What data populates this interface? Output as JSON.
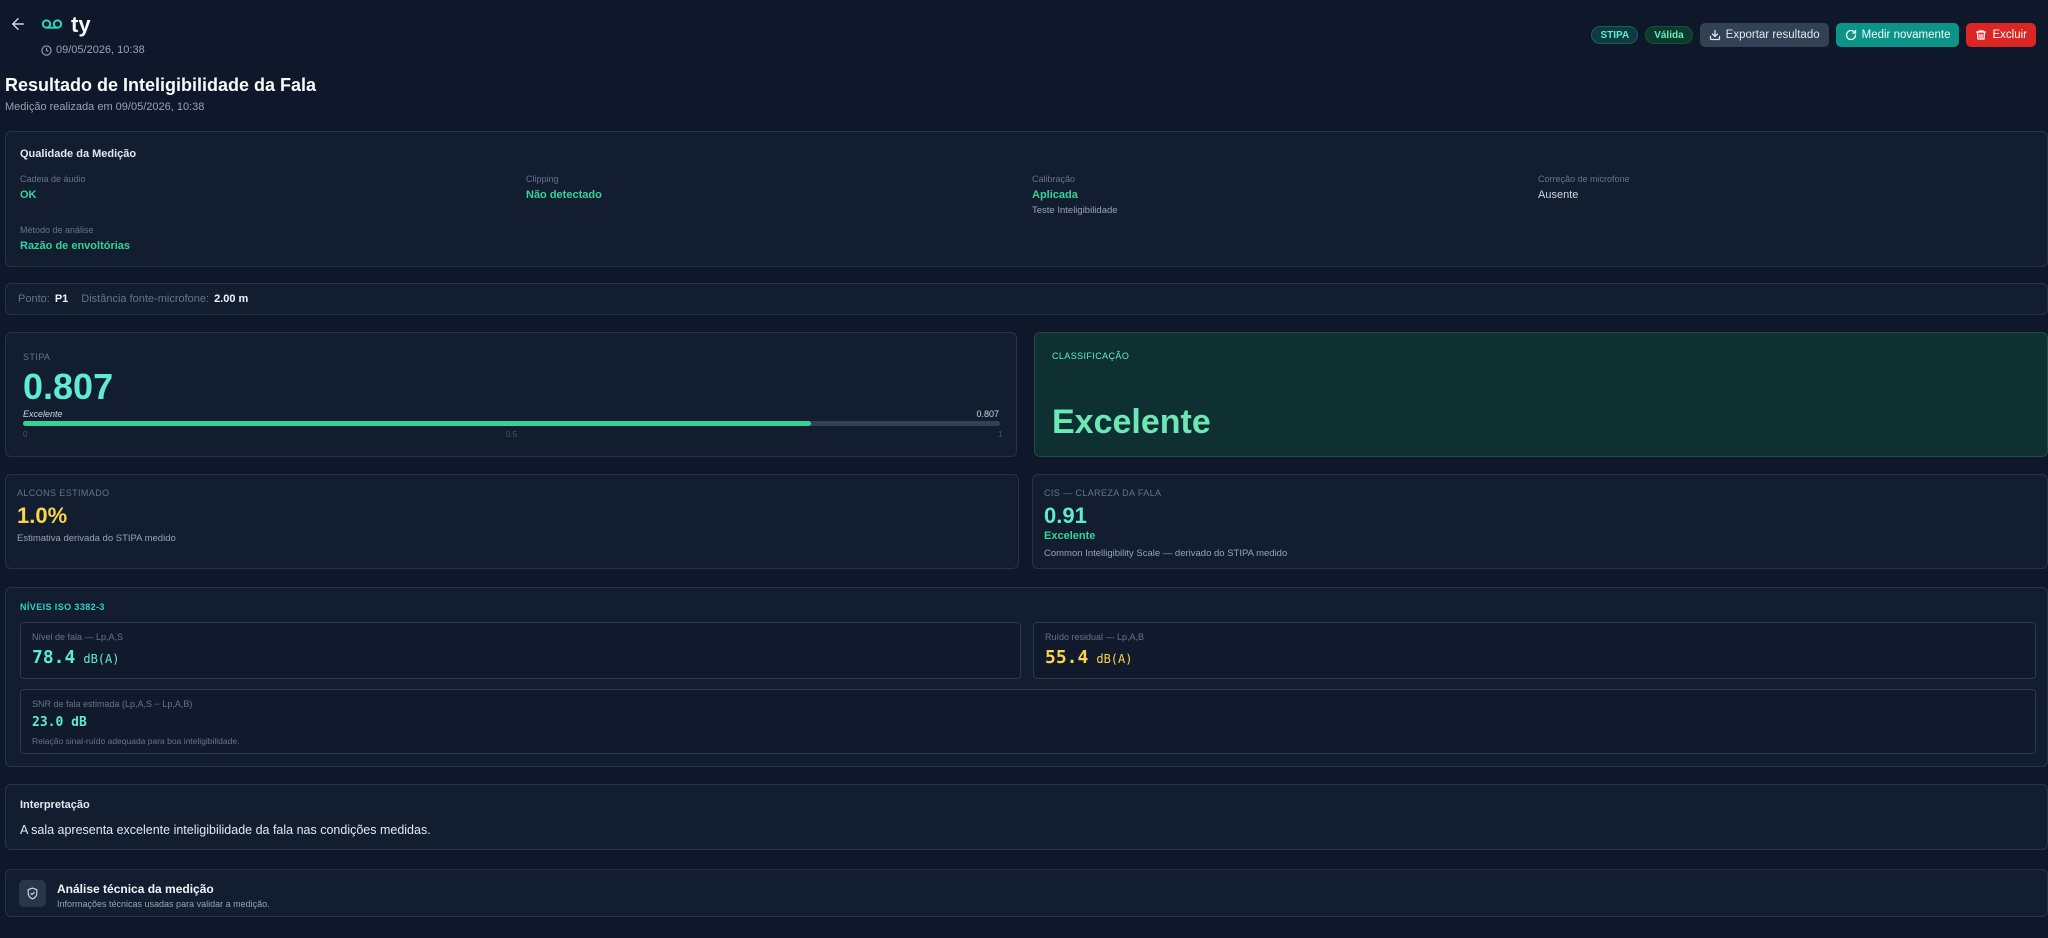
{
  "header": {
    "title": "ty",
    "date": "09/05/2026, 10:38",
    "badges": {
      "method": "STIPA",
      "status": "Válida"
    },
    "buttons": {
      "export": "Exportar resultado",
      "measure": "Medir novamente",
      "delete": "Excluir"
    }
  },
  "page": {
    "title": "Resultado de Inteligibilidade da Fala",
    "subtitle": "Medição realizada em 09/05/2026, 10:38"
  },
  "quality": {
    "title": "Qualidade da Medição",
    "items": [
      {
        "label": "Cadeia de áudio",
        "value": "OK"
      },
      {
        "label": "Clipping",
        "value": "Não detectado"
      },
      {
        "label": "Calibração",
        "value": "Aplicada",
        "note": "Teste Inteligibilidade"
      },
      {
        "label": "Correção de microfone",
        "value": "Ausente"
      },
      {
        "label": "Método de análise",
        "value": "Razão de envoltórias"
      }
    ]
  },
  "point": {
    "point_label": "Ponto:",
    "point_value": "P1",
    "distance_label": "Distância fonte-microfone:",
    "distance_value": "2.00 m"
  },
  "stipa": {
    "label": "STIPA",
    "value": "0.807",
    "bar_label": "Excelente",
    "bar_value_text": "0.807",
    "fraction": 0.807,
    "ticks": [
      "0",
      "0.5",
      "1"
    ]
  },
  "classification": {
    "label": "CLASSIFICAÇÃO",
    "value": "Excelente"
  },
  "alcons": {
    "label": "ALCONS ESTIMADO",
    "value": "1.0%",
    "note": "Estimativa derivada do STIPA medido"
  },
  "cis": {
    "label": "CIS — CLAREZA DA FALA",
    "value": "0.91",
    "rating": "Excelente",
    "note": "Common Intelligibility Scale — derivado do STIPA medido"
  },
  "iso": {
    "title": "NÍVEIS ISO 3382-3",
    "speech": {
      "label": "Nível de fala — Lp,A,S",
      "value": "78.4",
      "unit": "dB(A)"
    },
    "noise": {
      "label": "Ruído residual — Lp,A,B",
      "value": "55.4",
      "unit": "dB(A)"
    },
    "snr": {
      "label": "SNR de fala estimada (Lp,A,S − Lp,A,B)",
      "value": "23.0 dB",
      "note": "Relação sinal-ruído adequada para boa inteligibilidade."
    }
  },
  "interpretation": {
    "title": "Interpretação",
    "text": "A sala apresenta excelente inteligibilidade da fala nas condições medidas."
  },
  "technical": {
    "title": "Análise técnica da medição",
    "subtitle": "Informações técnicas usadas para validar a medição."
  },
  "colors": {
    "background": "#0f172a",
    "accent_teal": "#5eead4",
    "good_green": "#34d399",
    "warn_yellow": "#fcd34d",
    "danger_red": "#dc2626"
  },
  "icons": [
    "arrow-left-icon",
    "voicemail-icon",
    "clock-icon",
    "download-icon",
    "refresh-icon",
    "trash-icon",
    "shield-check-icon"
  ]
}
